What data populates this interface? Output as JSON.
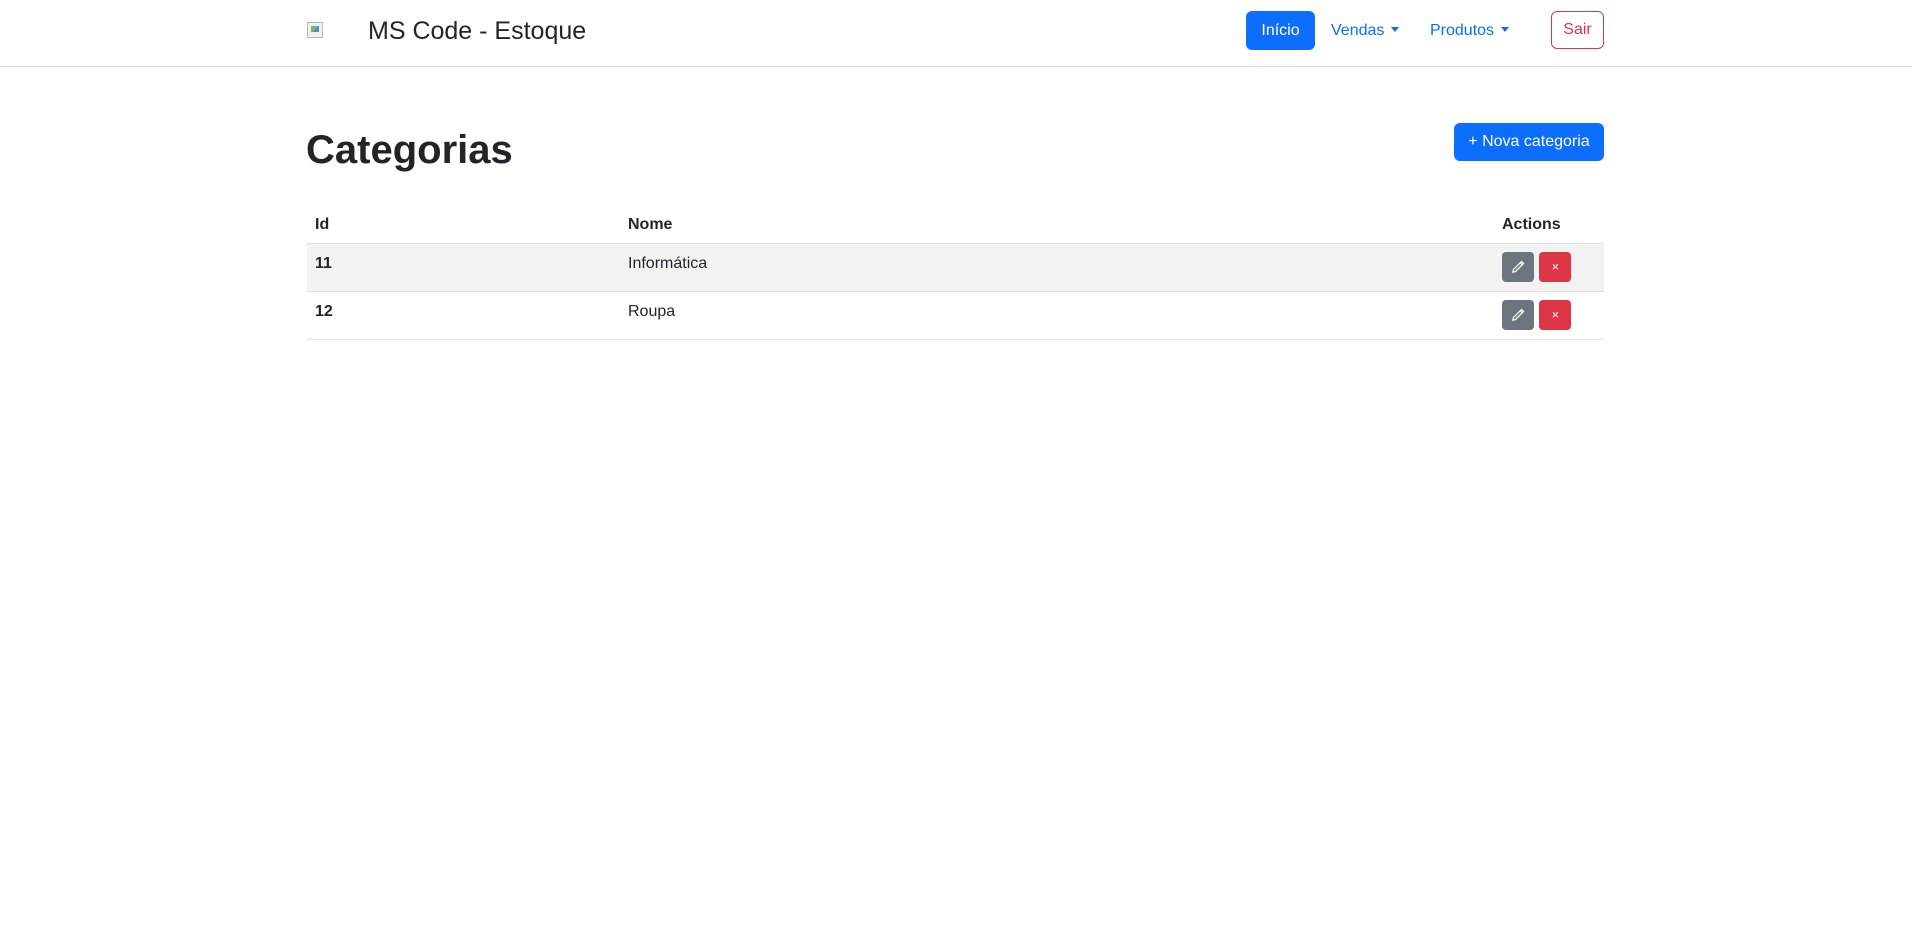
{
  "navbar": {
    "brand": "MS Code - Estoque",
    "home_label": "Início",
    "menus": [
      {
        "label": "Vendas"
      },
      {
        "label": "Produtos"
      }
    ],
    "logout_label": "Sair"
  },
  "page": {
    "title": "Categorias",
    "new_button_label": "+ Nova categoria"
  },
  "table": {
    "headers": [
      "Id",
      "Nome",
      "Actions"
    ],
    "rows": [
      {
        "id": "11",
        "nome": "Informática"
      },
      {
        "id": "12",
        "nome": "Roupa"
      }
    ],
    "delete_glyph": "×"
  },
  "colors": {
    "primary": "#0d6efd",
    "danger": "#dc3545",
    "secondary": "#6c757d"
  },
  "icons": {
    "brand": "broken-image-icon",
    "dropdown": "caret-down-icon",
    "edit": "pencil-icon",
    "delete": "close-icon"
  }
}
